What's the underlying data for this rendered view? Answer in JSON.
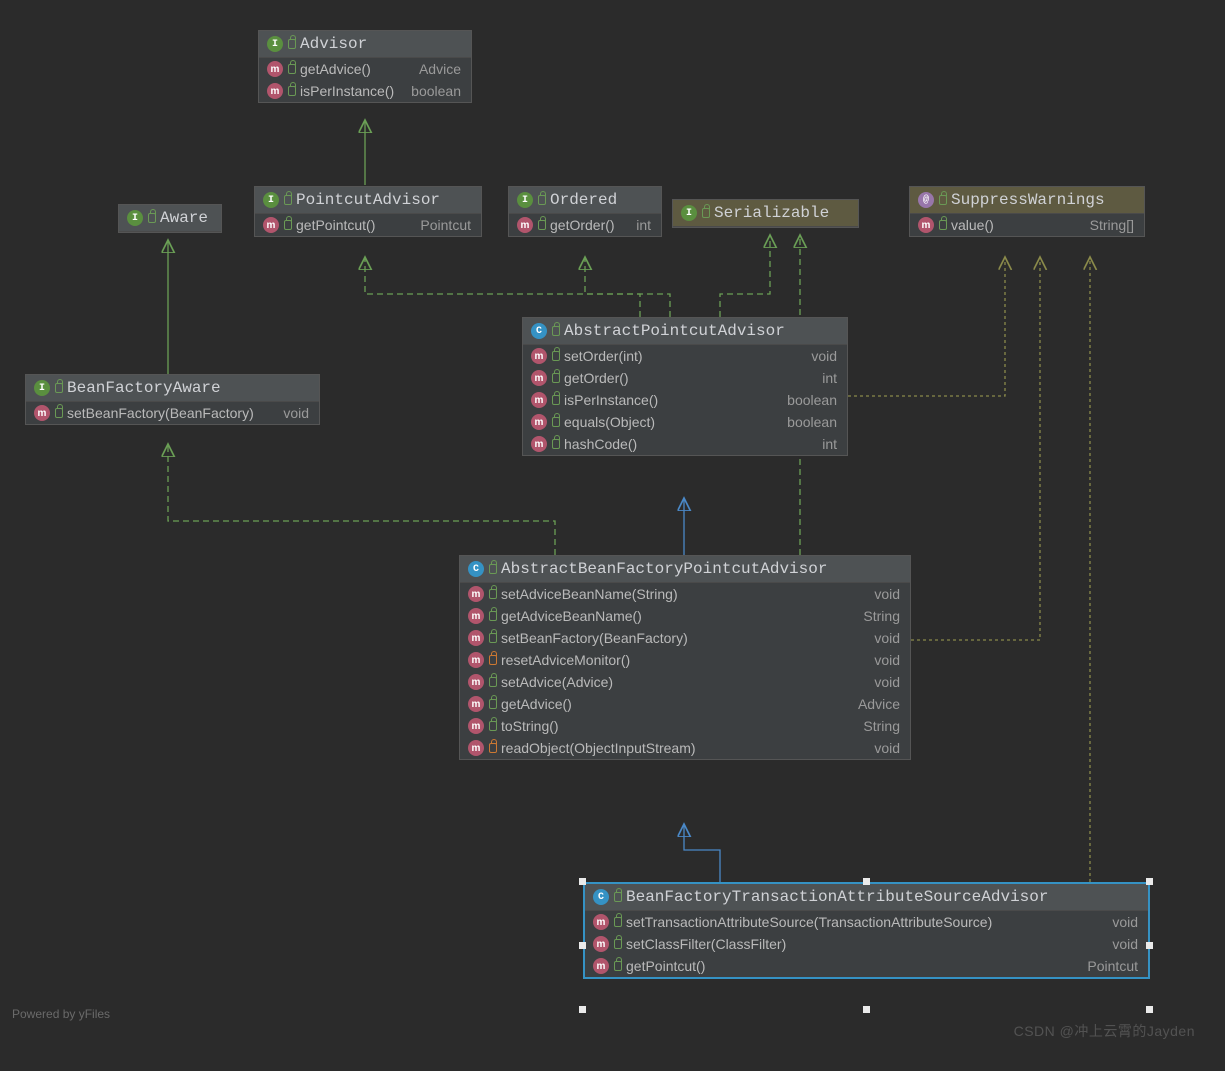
{
  "footer": "Powered by yFiles",
  "watermark": "CSDN @冲上云霄的Jayden",
  "classes": {
    "advisor": {
      "name": "Advisor",
      "members": [
        {
          "name": "getAdvice()",
          "type": "Advice",
          "acc": "green"
        },
        {
          "name": "isPerInstance()",
          "type": "boolean",
          "acc": "green"
        }
      ]
    },
    "aware": {
      "name": "Aware"
    },
    "pointcutAdvisor": {
      "name": "PointcutAdvisor",
      "members": [
        {
          "name": "getPointcut()",
          "type": "Pointcut",
          "acc": "green"
        }
      ]
    },
    "ordered": {
      "name": "Ordered",
      "members": [
        {
          "name": "getOrder()",
          "type": "int",
          "acc": "green"
        }
      ]
    },
    "serializable": {
      "name": "Serializable"
    },
    "suppressWarnings": {
      "name": "SuppressWarnings",
      "members": [
        {
          "name": "value()",
          "type": "String[]",
          "acc": "green"
        }
      ]
    },
    "beanFactoryAware": {
      "name": "BeanFactoryAware",
      "members": [
        {
          "name": "setBeanFactory(BeanFactory)",
          "type": "void",
          "acc": "green"
        }
      ]
    },
    "abstractPointcutAdvisor": {
      "name": "AbstractPointcutAdvisor",
      "members": [
        {
          "name": "setOrder(int)",
          "type": "void",
          "acc": "green"
        },
        {
          "name": "getOrder()",
          "type": "int",
          "acc": "green"
        },
        {
          "name": "isPerInstance()",
          "type": "boolean",
          "acc": "green"
        },
        {
          "name": "equals(Object)",
          "type": "boolean",
          "acc": "green"
        },
        {
          "name": "hashCode()",
          "type": "int",
          "acc": "green"
        }
      ]
    },
    "abstractBeanFactoryPointcutAdvisor": {
      "name": "AbstractBeanFactoryPointcutAdvisor",
      "members": [
        {
          "name": "setAdviceBeanName(String)",
          "type": "void",
          "acc": "green"
        },
        {
          "name": "getAdviceBeanName()",
          "type": "String",
          "acc": "green"
        },
        {
          "name": "setBeanFactory(BeanFactory)",
          "type": "void",
          "acc": "green"
        },
        {
          "name": "resetAdviceMonitor()",
          "type": "void",
          "acc": "orange"
        },
        {
          "name": "setAdvice(Advice)",
          "type": "void",
          "acc": "green"
        },
        {
          "name": "getAdvice()",
          "type": "Advice",
          "acc": "green"
        },
        {
          "name": "toString()",
          "type": "String",
          "acc": "green"
        },
        {
          "name": "readObject(ObjectInputStream)",
          "type": "void",
          "acc": "orange"
        }
      ]
    },
    "bftasa": {
      "name": "BeanFactoryTransactionAttributeSourceAdvisor",
      "members": [
        {
          "name": "setTransactionAttributeSource(TransactionAttributeSource)",
          "type": "void",
          "acc": "green"
        },
        {
          "name": "setClassFilter(ClassFilter)",
          "type": "void",
          "acc": "green"
        },
        {
          "name": "getPointcut()",
          "type": "Pointcut",
          "acc": "green"
        }
      ]
    }
  }
}
